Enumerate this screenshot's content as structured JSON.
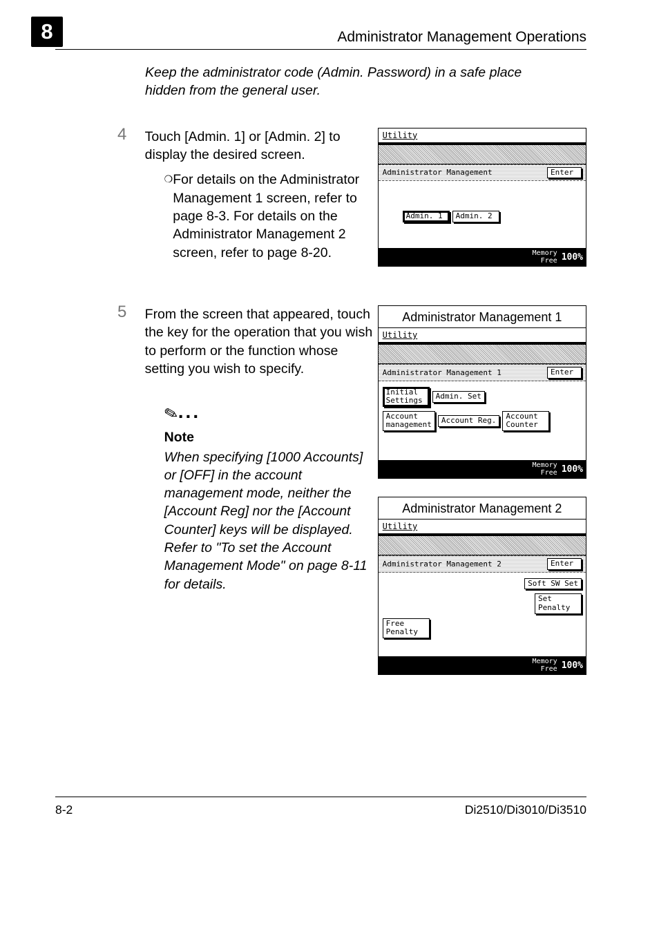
{
  "chapter_number": "8",
  "header_title": "Administrator Management Operations",
  "intro_note": "Keep the administrator code (Admin. Password) in a safe place hidden from the general user.",
  "step4": {
    "num": "4",
    "text": "Touch [Admin. 1] or [Admin. 2] to display the desired screen.",
    "bullet": "For details on the Administrator Management 1 screen, refer to page 8-3. For details on the Administrator Management 2 screen, refer to page 8-20."
  },
  "step5": {
    "num": "5",
    "text": "From the screen that appeared, touch the key for the operation that you wish to perform or the function whose setting you wish to specify."
  },
  "note": {
    "heading": "Note",
    "body": "When specifying [1000 Accounts] or [OFF] in the account management mode, neither the [Account Reg] nor the [Account Counter] keys will be displayed. Refer to \"To set the Account Management Mode\" on page 8-11 for details."
  },
  "lcd_top": {
    "title": "Utility",
    "rowlabel": "Administrator Management",
    "enter": "Enter",
    "btn1": "Admin. 1",
    "btn2": "Admin. 2",
    "memory": "Memory",
    "free": "Free",
    "pct": "100%"
  },
  "lcd1": {
    "caption": "Administrator Management 1",
    "title": "Utility",
    "rowlabel": "Administrator Management 1",
    "enter": "Enter",
    "initial": "Initial\nSettings",
    "adminset": "Admin. Set",
    "accmgmt": "Account\nmanagement",
    "accreg": "Account Reg.",
    "acccnt": "Account\nCounter",
    "memory": "Memory",
    "free": "Free",
    "pct": "100%"
  },
  "lcd2": {
    "caption": "Administrator Management 2",
    "title": "Utility",
    "rowlabel": "Administrator Management 2",
    "enter": "Enter",
    "softsw": "Soft SW Set",
    "setpenalty": "Set\nPenalty",
    "freepenalty": "Free\nPenalty",
    "memory": "Memory",
    "free": "Free",
    "pct": "100%"
  },
  "footer": {
    "page": "8-2",
    "model": "Di2510/Di3010/Di3510"
  }
}
